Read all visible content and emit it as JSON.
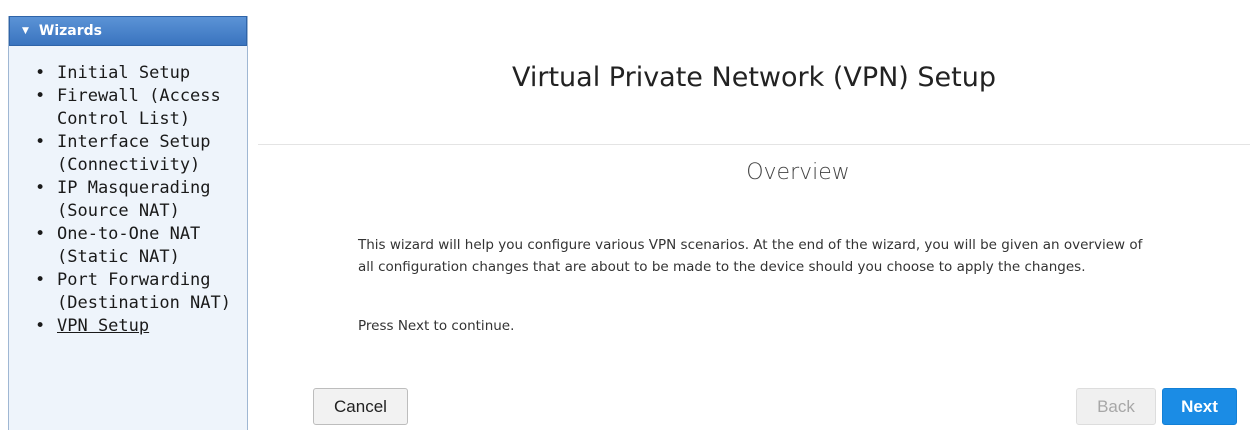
{
  "sidebar": {
    "header": "Wizards",
    "items": [
      {
        "label": "Initial Setup"
      },
      {
        "label": "Firewall (Access Control List)"
      },
      {
        "label": "Interface Setup (Connectivity)"
      },
      {
        "label": "IP Masquerading (Source NAT)"
      },
      {
        "label": "One-to-One NAT (Static NAT)"
      },
      {
        "label": "Port Forwarding (Destination NAT)"
      },
      {
        "label": "VPN Setup"
      }
    ]
  },
  "main": {
    "title": "Virtual Private Network (VPN) Setup",
    "section_title": "Overview",
    "description": "This wizard will help you configure various VPN scenarios. At the end of the wizard, you will be given an overview of all configuration changes that are about to be made to the device should you choose to apply the changes.",
    "hint": "Press Next to continue."
  },
  "buttons": {
    "cancel": "Cancel",
    "back": "Back",
    "next": "Next"
  },
  "colors": {
    "sidebar_header": "#3a74bf",
    "sidebar_bg": "#eef4fb",
    "next_button": "#1b8ce5"
  }
}
